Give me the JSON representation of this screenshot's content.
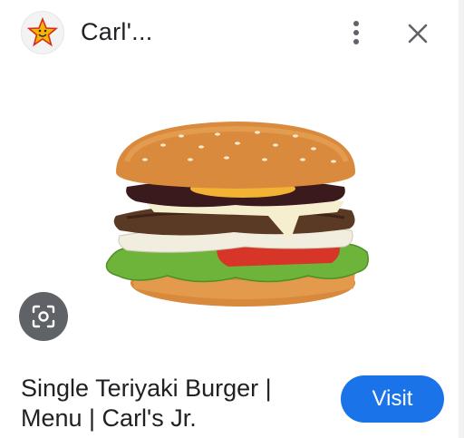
{
  "header": {
    "site_name": "Carl'...",
    "logo_icon": "star-mascot-icon",
    "more_icon": "more-vert-icon",
    "close_icon": "close-icon"
  },
  "image": {
    "subject": "burger-photo"
  },
  "lens_icon": "lens-search-icon",
  "result": {
    "title": "Single Teriyaki Burger | Menu | Carl's Jr.",
    "visit_label": "Visit"
  },
  "colors": {
    "accent": "#1a73e8",
    "text": "#202124",
    "lens_bg": "#5f6368"
  }
}
